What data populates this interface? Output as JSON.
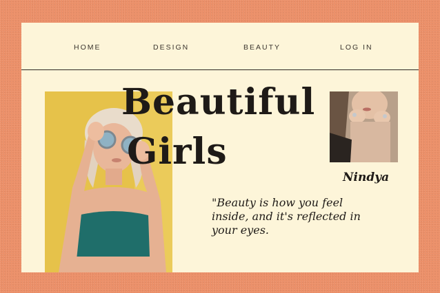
{
  "nav": {
    "items": [
      {
        "label": "HOME"
      },
      {
        "label": "DESIGN"
      },
      {
        "label": "BEAUTY"
      },
      {
        "label": "LOG IN"
      }
    ]
  },
  "hero": {
    "title_line1": "Beautiful",
    "title_line2": "Girls",
    "side_caption": "Nindya",
    "quote": "\"Beauty is how you feel inside, and it's reflected in your eyes."
  },
  "colors": {
    "background": "#ec8f68",
    "card": "#fdf5d9",
    "text": "#1e1a17",
    "photo_bg": "#e3bf46"
  }
}
